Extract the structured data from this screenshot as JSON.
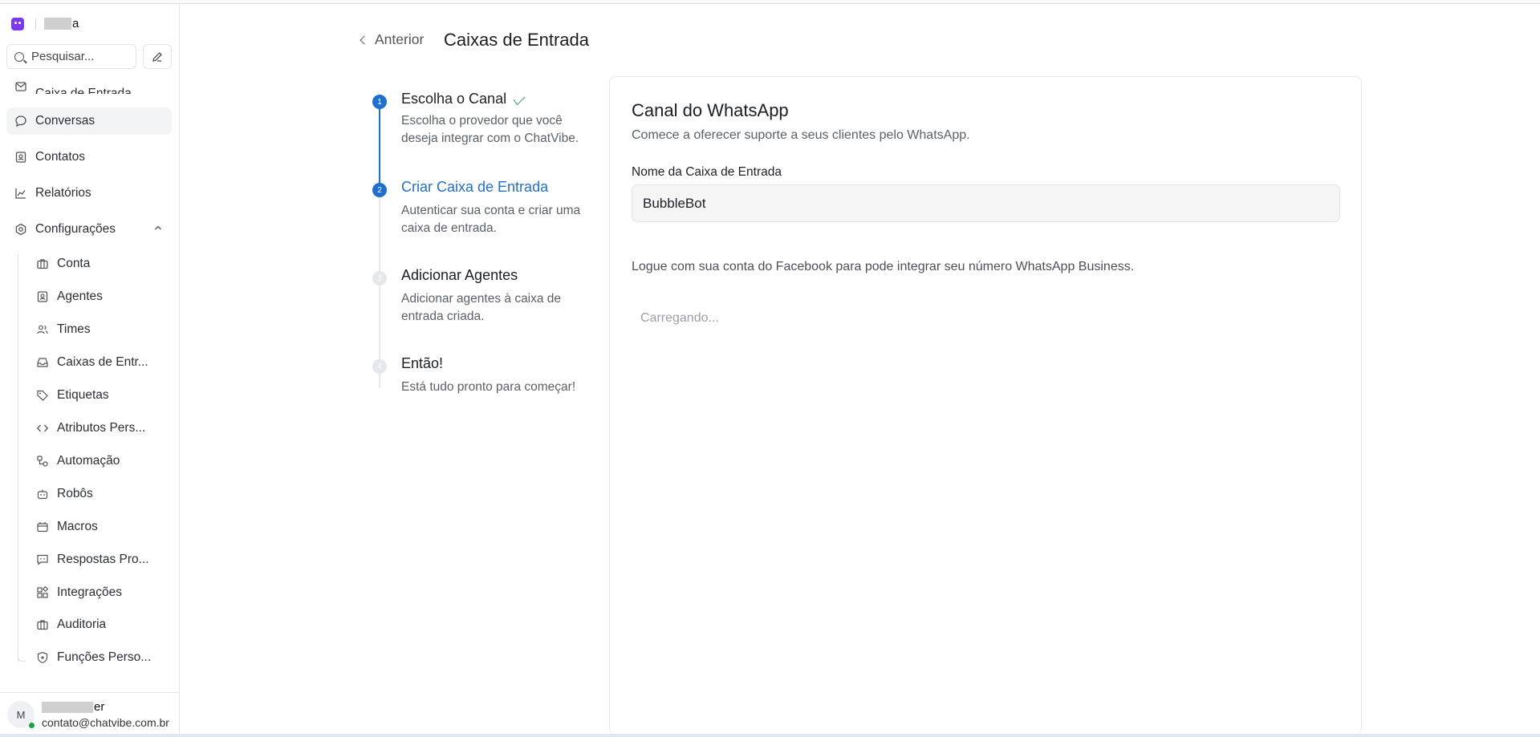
{
  "brand": {
    "name_suffix": "a"
  },
  "search": {
    "placeholder": "Pesquisar..."
  },
  "sidebar": {
    "partial_item": "Caixa de Entrada",
    "items": [
      {
        "label": "Conversas",
        "icon": "chat-icon"
      },
      {
        "label": "Contatos",
        "icon": "contacts-icon"
      },
      {
        "label": "Relatórios",
        "icon": "chart-icon"
      },
      {
        "label": "Configurações",
        "icon": "settings-icon"
      }
    ],
    "settings": [
      {
        "label": "Conta",
        "icon": "briefcase-icon"
      },
      {
        "label": "Agentes",
        "icon": "agent-icon"
      },
      {
        "label": "Times",
        "icon": "team-icon"
      },
      {
        "label": "Caixas de Entr...",
        "icon": "inbox-icon"
      },
      {
        "label": "Etiquetas",
        "icon": "tag-icon"
      },
      {
        "label": "Atributos Pers...",
        "icon": "code-icon"
      },
      {
        "label": "Automação",
        "icon": "automation-icon"
      },
      {
        "label": "Robôs",
        "icon": "bot-icon"
      },
      {
        "label": "Macros",
        "icon": "macro-icon"
      },
      {
        "label": "Respostas Pro...",
        "icon": "canned-icon"
      },
      {
        "label": "Integrações",
        "icon": "integrations-icon"
      },
      {
        "label": "Auditoria",
        "icon": "audit-icon"
      },
      {
        "label": "Funções Perso...",
        "icon": "shield-icon"
      }
    ]
  },
  "profile": {
    "initial": "M",
    "name_suffix": "er",
    "email": "contato@chatvibe.com.br"
  },
  "header": {
    "back_label": "Anterior",
    "title": "Caixas de Entrada"
  },
  "steps": [
    {
      "number": "1",
      "title": "Escolha o Canal",
      "desc": "Escolha o provedor que você deseja integrar com o ChatVibe.",
      "state": "done"
    },
    {
      "number": "2",
      "title": "Criar Caixa de Entrada",
      "desc": "Autenticar sua conta e criar uma caixa de entrada.",
      "state": "current"
    },
    {
      "number": "3",
      "title": "Adicionar Agentes",
      "desc": "Adicionar agentes à caixa de entrada criada.",
      "state": "todo"
    },
    {
      "number": "4",
      "title": "Então!",
      "desc": "Está tudo pronto para começar!",
      "state": "todo"
    }
  ],
  "card": {
    "title": "Canal do WhatsApp",
    "subtitle": "Comece a oferecer suporte a seus clientes pelo WhatsApp.",
    "field_label": "Nome da Caixa de Entrada",
    "field_value": "BubbleBot",
    "info": "Logue com sua conta do Facebook para pode integrar seu número WhatsApp Business.",
    "loading": "Carregando..."
  },
  "colors": {
    "accent": "#1f6fd1",
    "brand": "#7c3aed",
    "success": "#22a06b"
  }
}
